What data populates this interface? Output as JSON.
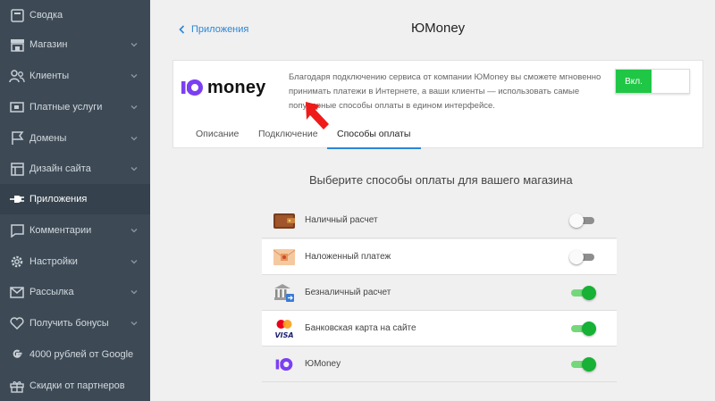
{
  "sidebar": {
    "items": [
      {
        "label": "Сводка",
        "icon": "dashboard-icon",
        "chevron": false
      },
      {
        "label": "Магазин",
        "icon": "store-icon",
        "chevron": true
      },
      {
        "label": "Клиенты",
        "icon": "users-icon",
        "chevron": true
      },
      {
        "label": "Платные услуги",
        "icon": "wallet-icon",
        "chevron": true
      },
      {
        "label": "Домены",
        "icon": "flag-icon",
        "chevron": true
      },
      {
        "label": "Дизайн сайта",
        "icon": "layout-icon",
        "chevron": true
      },
      {
        "label": "Приложения",
        "icon": "plug-icon",
        "chevron": false
      },
      {
        "label": "Комментарии",
        "icon": "comment-icon",
        "chevron": true
      },
      {
        "label": "Настройки",
        "icon": "gear-icon",
        "chevron": true
      },
      {
        "label": "Рассылка",
        "icon": "mail-icon",
        "chevron": true
      },
      {
        "label": "Получить бонусы",
        "icon": "heart-icon",
        "chevron": true
      },
      {
        "label": "4000 рублей от Google",
        "icon": "google-icon",
        "chevron": false
      },
      {
        "label": "Скидки от партнеров",
        "icon": "gift-icon",
        "chevron": false
      }
    ],
    "active_index": 6
  },
  "header": {
    "back_label": "Приложения",
    "title": "ЮMoney"
  },
  "app_card": {
    "logo_text": "money",
    "description": "Благодаря подключению сервиса от компании ЮMoney вы сможете мгновенно принимать платежи в Интернете, а ваши клиенты — использовать самые популярные способы оплаты в едином интерфейсе.",
    "toggle_label": "Вкл.",
    "tabs": [
      {
        "label": "Описание"
      },
      {
        "label": "Подключение"
      },
      {
        "label": "Способы оплаты"
      }
    ],
    "active_tab": 2
  },
  "methods": {
    "title": "Выберите способы оплаты для вашего магазина",
    "items": [
      {
        "label": "Наличный расчет",
        "icon": "wallet-icon",
        "enabled": false
      },
      {
        "label": "Наложенный платеж",
        "icon": "envelope-icon",
        "enabled": false
      },
      {
        "label": "Безналичный расчет",
        "icon": "bank-icon",
        "enabled": true
      },
      {
        "label": "Банковская карта на сайте",
        "icon": "card-icon",
        "enabled": true
      },
      {
        "label": "ЮMoney",
        "icon": "yoomoney-icon",
        "enabled": true
      }
    ]
  },
  "colors": {
    "sidebar_bg": "#3d4a56",
    "accent_blue": "#2a86d6",
    "toggle_green": "#20c645",
    "yoomoney_purple": "#7b3ff2"
  }
}
